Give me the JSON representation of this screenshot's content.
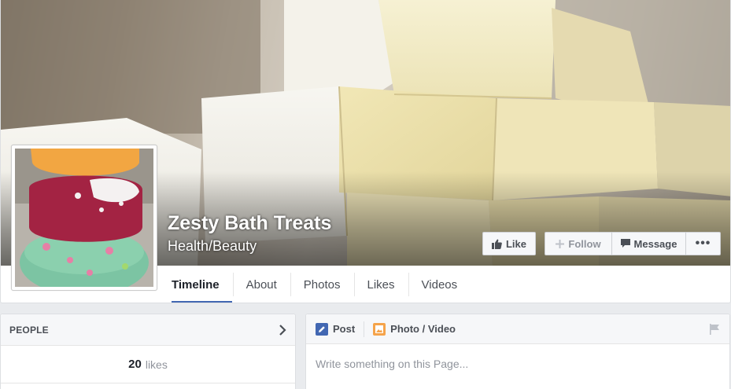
{
  "page": {
    "name": "Zesty Bath Treats",
    "category": "Health/Beauty"
  },
  "actions": {
    "like_label": "Like",
    "follow_label": "Follow",
    "message_label": "Message",
    "more_label": "•••"
  },
  "tabs": [
    {
      "label": "Timeline",
      "active": true
    },
    {
      "label": "About",
      "active": false
    },
    {
      "label": "Photos",
      "active": false
    },
    {
      "label": "Likes",
      "active": false
    },
    {
      "label": "Videos",
      "active": false
    }
  ],
  "people": {
    "title": "PEOPLE",
    "likes_count": "20",
    "likes_label": "likes"
  },
  "composer": {
    "post_label": "Post",
    "photo_label": "Photo / Video",
    "placeholder": "Write something on this Page..."
  },
  "colors": {
    "accent": "#4267b2",
    "background": "#e9ebee",
    "text_secondary": "#90949c"
  },
  "icons": {
    "like": "thumbs-up-icon",
    "follow": "plus-icon",
    "message": "speech-bubble-icon",
    "chevron": "chevron-right-icon",
    "post": "pencil-icon",
    "photo": "photo-icon",
    "flag": "flag-icon"
  }
}
